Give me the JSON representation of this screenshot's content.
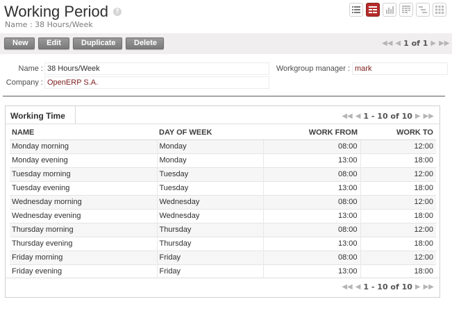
{
  "header": {
    "title": "Working Period",
    "help_icon": "question-mark-icon",
    "subtitle": "Name : 38 Hours/Week",
    "view_modes": [
      {
        "name": "list-view-icon",
        "active": false
      },
      {
        "name": "form-view-icon",
        "active": true
      },
      {
        "name": "graph-view-icon",
        "active": false
      },
      {
        "name": "calendar-view-icon",
        "active": false
      },
      {
        "name": "gantt-view-icon",
        "active": false
      },
      {
        "name": "diagram-view-icon",
        "active": false
      }
    ]
  },
  "toolbar": {
    "new_label": "New",
    "edit_label": "Edit",
    "duplicate_label": "Duplicate",
    "delete_label": "Delete",
    "pager_text": "1 of 1"
  },
  "form": {
    "name_label": "Name :",
    "name_value": "38 Hours/Week",
    "company_label": "Company :",
    "company_value": "OpenERP S.A.",
    "manager_label": "Workgroup manager :",
    "manager_value": "mark"
  },
  "working_time": {
    "tab_label": "Working Time",
    "pager_text": "1 - 10 of 10",
    "columns": [
      "NAME",
      "DAY OF WEEK",
      "WORK FROM",
      "WORK TO"
    ],
    "rows": [
      {
        "name": "Monday morning",
        "day": "Monday",
        "from": "08:00",
        "to": "12:00"
      },
      {
        "name": "Monday evening",
        "day": "Monday",
        "from": "13:00",
        "to": "18:00"
      },
      {
        "name": "Tuesday morning",
        "day": "Tuesday",
        "from": "08:00",
        "to": "12:00"
      },
      {
        "name": "Tuesday evening",
        "day": "Tuesday",
        "from": "13:00",
        "to": "18:00"
      },
      {
        "name": "Wednesday morning",
        "day": "Wednesday",
        "from": "08:00",
        "to": "12:00"
      },
      {
        "name": "Wednesday evening",
        "day": "Wednesday",
        "from": "13:00",
        "to": "18:00"
      },
      {
        "name": "Thursday morning",
        "day": "Thursday",
        "from": "08:00",
        "to": "12:00"
      },
      {
        "name": "Thursday evening",
        "day": "Thursday",
        "from": "13:00",
        "to": "18:00"
      },
      {
        "name": "Friday morning",
        "day": "Friday",
        "from": "08:00",
        "to": "12:00"
      },
      {
        "name": "Friday evening",
        "day": "Friday",
        "from": "13:00",
        "to": "18:00"
      }
    ],
    "footer_pager_text": "1 - 10 of 10"
  },
  "colors": {
    "accent": "#b52b2b",
    "link": "#7c1a1a",
    "button": "#8a8a8a"
  }
}
